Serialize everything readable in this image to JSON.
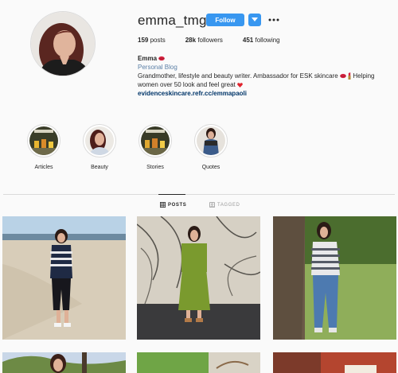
{
  "profile": {
    "username": "emma_tmgr",
    "follow_label": "Follow",
    "stats": [
      {
        "count": "159",
        "label": "posts"
      },
      {
        "count": "28k",
        "label": "followers"
      },
      {
        "count": "451",
        "label": "following"
      }
    ],
    "display_name": "Emma",
    "category": "Personal Blog",
    "bio_line1": "Grandmother, lifestyle and beauty writer. Ambassador for ESK skincare",
    "bio_line1_tail": " Helping",
    "bio_line2": "women over 50 look and feel great",
    "website": "evidenceskincare.refr.cc/emmapaoli"
  },
  "highlights": [
    {
      "label": "Articles"
    },
    {
      "label": "Beauty"
    },
    {
      "label": "Stories"
    },
    {
      "label": "Quotes"
    }
  ],
  "tabs": {
    "posts": "POSTS",
    "tagged": "TAGGED"
  },
  "colors": {
    "accent": "#3897f0",
    "link": "#003569",
    "category": "#5b7fa6"
  }
}
